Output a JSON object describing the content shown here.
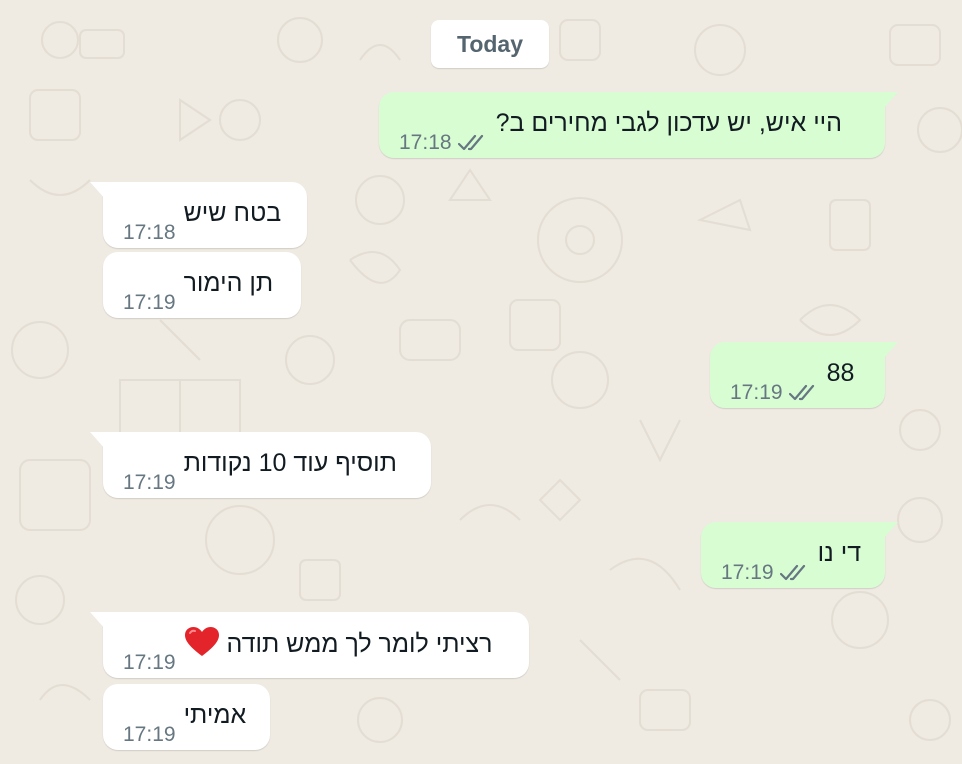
{
  "chat": {
    "date_divider": "Today",
    "messages": [
      {
        "direction": "outgoing",
        "text": "היי איש, יש עדכון לגבי מחירים ב?",
        "time": "17:18",
        "status_icon": "double-check-read-icon"
      },
      {
        "direction": "incoming",
        "text": "בטח שיש",
        "time": "17:18"
      },
      {
        "direction": "incoming",
        "text": "תן הימור",
        "time": "17:19"
      },
      {
        "direction": "outgoing",
        "text": "88",
        "time": "17:19",
        "status_icon": "double-check-read-icon"
      },
      {
        "direction": "incoming",
        "text": "תוסיף עוד 10 נקודות",
        "time": "17:19"
      },
      {
        "direction": "outgoing",
        "text": "די נו",
        "time": "17:19",
        "status_icon": "double-check-read-icon"
      },
      {
        "direction": "incoming",
        "text": "רציתי לומר לך ממש תודה",
        "emoji": "❤️",
        "emoji_name": "red-heart-icon",
        "time": "17:19"
      },
      {
        "direction": "incoming",
        "text": "אמיתי",
        "time": "17:19"
      }
    ]
  },
  "colors": {
    "chat_background": "#efeae2",
    "outgoing_bubble": "#d9fdd3",
    "incoming_bubble": "#ffffff",
    "timestamp": "#667781",
    "ticks": "#667781",
    "date_chip_text": "#54656f"
  }
}
